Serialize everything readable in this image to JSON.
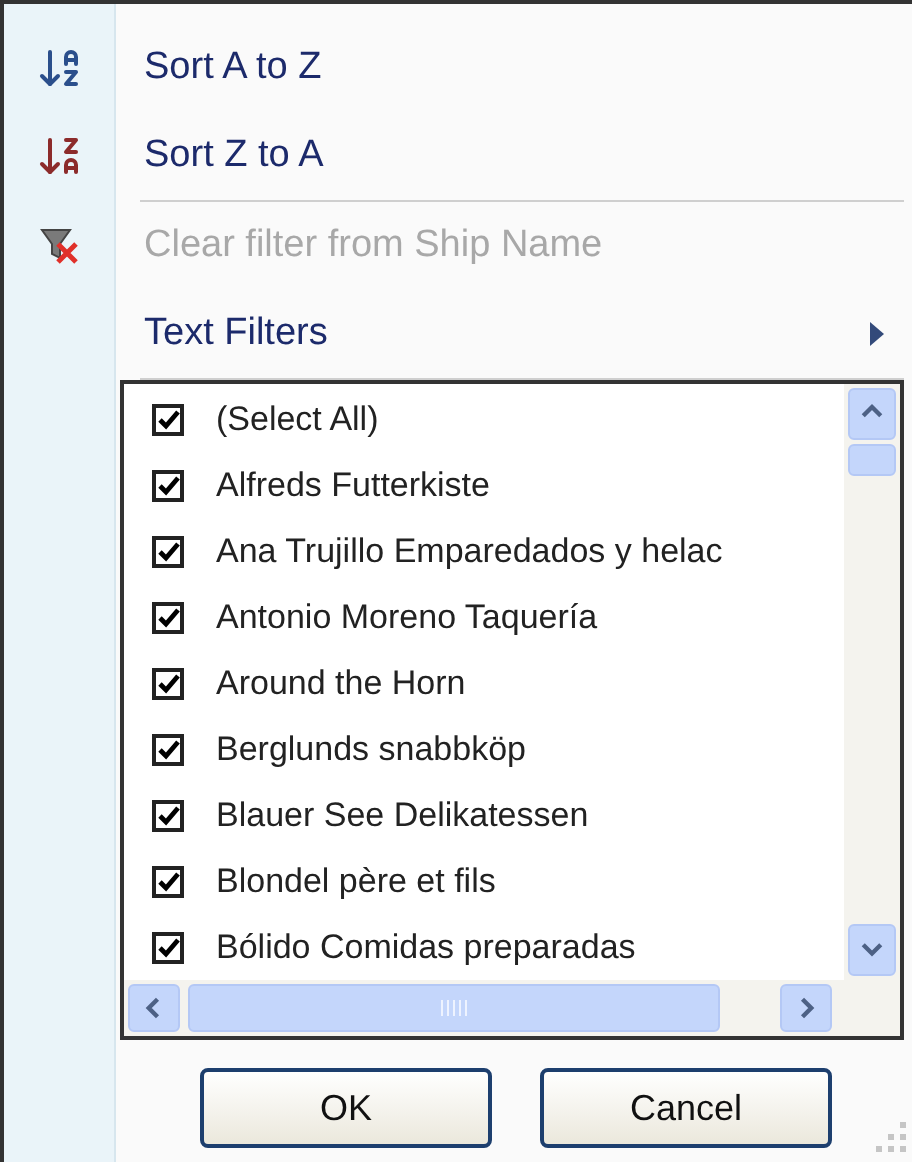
{
  "menu": [
    {
      "kind": "sort-asc",
      "label": "Sort A to Z",
      "disabled": false,
      "separator_after": false
    },
    {
      "kind": "sort-desc",
      "label": "Sort Z to A",
      "disabled": false,
      "separator_after": true
    },
    {
      "kind": "clear-filter",
      "label": "Clear filter from Ship Name",
      "disabled": true,
      "separator_after": false
    },
    {
      "kind": "submenu",
      "label": "Text Filters",
      "disabled": false,
      "separator_after": true
    }
  ],
  "values": [
    {
      "label": "(Select All)",
      "checked": true
    },
    {
      "label": "Alfreds Futterkiste",
      "checked": true
    },
    {
      "label": "Ana Trujillo Emparedados y helac",
      "checked": true
    },
    {
      "label": "Antonio Moreno Taquería",
      "checked": true
    },
    {
      "label": "Around the Horn",
      "checked": true
    },
    {
      "label": "Berglunds snabbköp",
      "checked": true
    },
    {
      "label": "Blauer See Delikatessen",
      "checked": true
    },
    {
      "label": "Blondel père et fils",
      "checked": true
    },
    {
      "label": "Bólido Comidas preparadas",
      "checked": true
    }
  ],
  "buttons": [
    "OK",
    "Cancel"
  ]
}
